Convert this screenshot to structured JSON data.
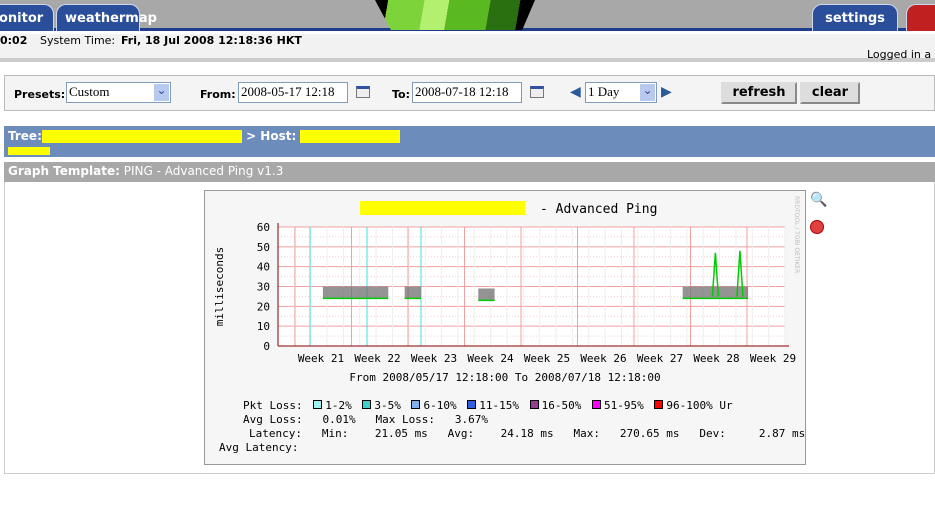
{
  "tabs": {
    "monitor": "onitor",
    "weathermap": "weathermap",
    "settings": "settings"
  },
  "info": {
    "uptime": "0:02",
    "system_time_label": "System Time:",
    "system_time": "Fri, 18 Jul 2008 12:18:36 HKT",
    "logged_in": "Logged in a"
  },
  "form": {
    "presets_label": "Presets:",
    "presets_value": "Custom",
    "from_label": "From:",
    "from_value": "2008-05-17 12:18",
    "to_label": "To:",
    "to_value": "2008-07-18 12:18",
    "span_value": "1 Day",
    "refresh": "refresh",
    "clear": "clear"
  },
  "tree": {
    "tree_label": "Tree:",
    "host_label": "> Host:"
  },
  "graph_template": {
    "label": "Graph Template:",
    "value": "PING - Advanced Ping v1.3"
  },
  "chart_data": {
    "type": "area",
    "title": "- Advanced Ping",
    "ylabel": "milliseconds",
    "ylim": [
      0,
      60
    ],
    "yticks": [
      0,
      10,
      20,
      30,
      40,
      50,
      60
    ],
    "xlim": [
      "2008-05-17 12:18",
      "2008-07-18 12:18"
    ],
    "xticks": [
      "Week 21",
      "Week 22",
      "Week 23",
      "Week 24",
      "Week 25",
      "Week 26",
      "Week 27",
      "Week 28",
      "Week 29"
    ],
    "subtitle": "From 2008/05/17 12:18:00 To 2008/07/18 12:18:00",
    "watermark": "RRDTOOL / TOBI OETIKER",
    "segments": [
      {
        "start": "2008-05-23",
        "end": "2008-05-31",
        "min": 24,
        "max": 30
      },
      {
        "start": "2008-06-02",
        "end": "2008-06-04",
        "min": 24,
        "max": 30
      },
      {
        "start": "2008-06-11",
        "end": "2008-06-13",
        "min": 23,
        "max": 29
      },
      {
        "start": "2008-07-06",
        "end": "2008-07-14",
        "min": 24,
        "max": 30
      }
    ],
    "spikes": [
      {
        "date": "2008-07-10",
        "value": 47
      },
      {
        "date": "2008-07-13",
        "value": 48
      }
    ],
    "colors": {
      "latency": "#00cc00",
      "band": "#707070",
      "grid": "#f0a0a0",
      "loss": "#40e0e0"
    }
  },
  "legend": {
    "pkt_loss_label": "Pkt Loss:",
    "items": [
      {
        "label": "1-2%",
        "color": "#a0f0f0"
      },
      {
        "label": "3-5%",
        "color": "#40d0d0"
      },
      {
        "label": "6-10%",
        "color": "#80b0f0"
      },
      {
        "label": "11-15%",
        "color": "#3060e0"
      },
      {
        "label": "16-50%",
        "color": "#904090"
      },
      {
        "label": "51-95%",
        "color": "#ff00ff"
      },
      {
        "label": "96-100%",
        "color": "#ff0000"
      }
    ],
    "unknown": "Ur",
    "avg_loss": "Avg Loss:   0.01%   Max Loss:   3.67%",
    "latency": "Latency:   Min:    21.05 ms   Avg:    24.18 ms   Max:   270.65 ms   Dev:     2.87 ms",
    "avg_latency": "Avg Latency:"
  }
}
